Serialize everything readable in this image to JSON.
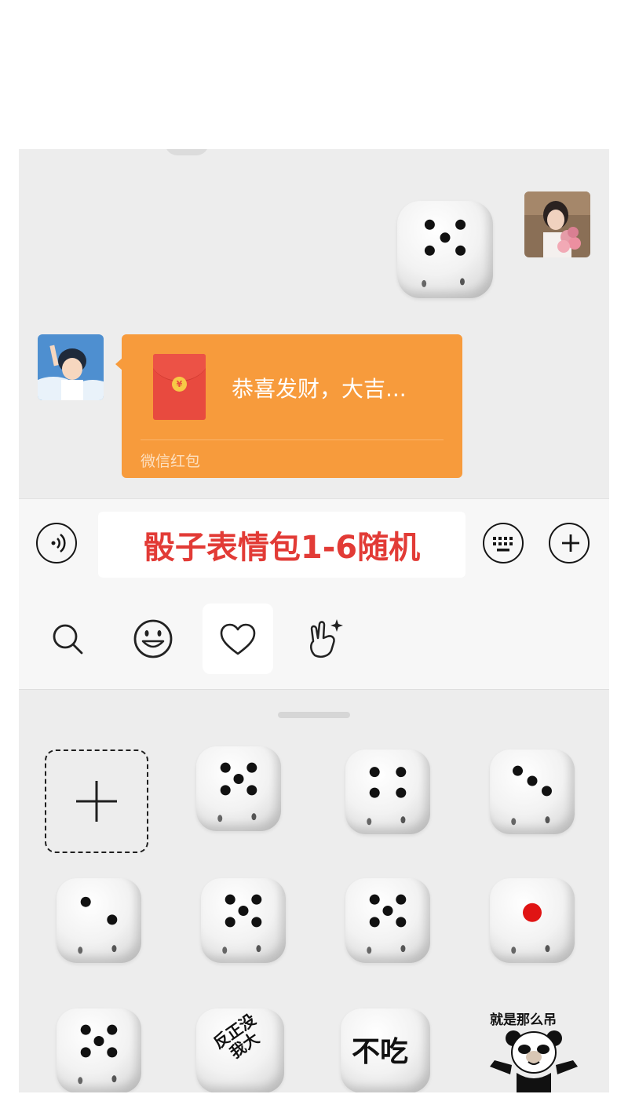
{
  "chat": {
    "red_packet": {
      "title": "恭喜发财，大吉...",
      "footer": "微信红包",
      "coin_symbol": "¥",
      "color": "#f79b3c"
    },
    "sent_dice_face": 5
  },
  "input_bar": {
    "text": "骰子表情包1-6随机",
    "text_color": "#e23b36",
    "voice_icon": "voice-icon",
    "keyboard_icon": "keyboard-icon",
    "plus_icon": "plus-icon"
  },
  "tabs": [
    {
      "icon": "search-icon",
      "active": false
    },
    {
      "icon": "emoji-icon",
      "active": false
    },
    {
      "icon": "heart-icon",
      "active": true
    },
    {
      "icon": "hand-gesture-icon",
      "active": false
    }
  ],
  "sticker_grid": {
    "add_icon": "plus-icon",
    "dice_faces": [
      5,
      4,
      3,
      2,
      5,
      5,
      1,
      5
    ],
    "stickers_text": {
      "dice_fanzheng": "反正没我大",
      "dice_buchi": "不吃",
      "panda_caption": "就是那么吊"
    }
  }
}
